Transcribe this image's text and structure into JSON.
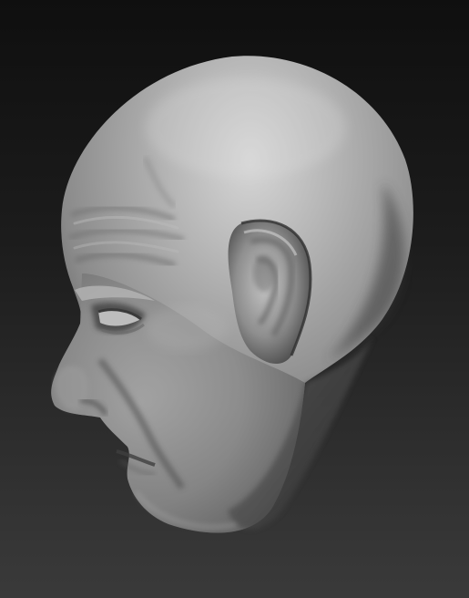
{
  "scene": {
    "subject": "sculpted-head-profile",
    "material_colors": {
      "highlight": "#cfcfcf",
      "midtone": "#8f8f8f",
      "shadow": "#3c3c3c"
    },
    "background_colors": {
      "top": "#0f0f0f",
      "bottom": "#3a3a3a"
    }
  }
}
